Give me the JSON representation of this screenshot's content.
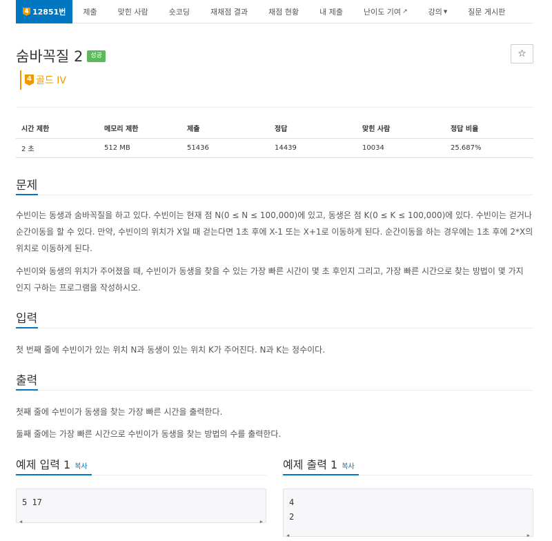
{
  "nav": {
    "active_tier": "4",
    "active_label": "12851번",
    "items": [
      "제출",
      "맞힌 사람",
      "숏코딩",
      "재채점 결과",
      "채점 현황",
      "내 제출",
      "난이도 기여",
      "강의"
    ],
    "ext_icon": "external-link-icon",
    "caret_icon": "caret-down-icon",
    "last": "질문 게시판"
  },
  "problem": {
    "title": "숨바꼭질 2",
    "status_badge": "성공",
    "star_icon": "☆",
    "tier_num": "4",
    "tier_name": "골드 IV"
  },
  "info": {
    "headers": [
      "시간 제한",
      "메모리 제한",
      "제출",
      "정답",
      "맞힌 사람",
      "정답 비율"
    ],
    "values": [
      "2 초",
      "512 MB",
      "51436",
      "14439",
      "10034",
      "25.687%"
    ]
  },
  "sections": {
    "problem_h": "문제",
    "problem_p1": "수빈이는 동생과 숨바꼭질을 하고 있다. 수빈이는 현재 점 N(0 ≤ N ≤ 100,000)에 있고, 동생은 점 K(0 ≤ K ≤ 100,000)에 있다. 수빈이는 걷거나 순간이동을 할 수 있다. 만약, 수빈이의 위치가 X일 때 걷는다면 1초 후에 X-1 또는 X+1로 이동하게 된다. 순간이동을 하는 경우에는 1초 후에 2*X의 위치로 이동하게 된다.",
    "problem_p2": "수빈이와 동생의 위치가 주어졌을 때, 수빈이가 동생을 찾을 수 있는 가장 빠른 시간이 몇 초 후인지 그리고, 가장 빠른 시간으로 찾는 방법이 몇 가지 인지 구하는 프로그램을 작성하시오.",
    "input_h": "입력",
    "input_p": "첫 번째 줄에 수빈이가 있는 위치 N과 동생이 있는 위치 K가 주어진다. N과 K는 정수이다.",
    "output_h": "출력",
    "output_p1": "첫째 줄에 수빈이가 동생을 찾는 가장 빠른 시간을 출력한다.",
    "output_p2": "둘째 줄에는 가장 빠른 시간으로 수빈이가 동생을 찾는 방법의 수를 출력한다."
  },
  "samples": {
    "input_h": "예제 입력 1",
    "output_h": "예제 출력 1",
    "copy": "복사",
    "input_text": "5 17",
    "output_line1": "4",
    "output_line2": "2"
  },
  "colors": {
    "nav_active": "#0076c0",
    "tier_gold": "#ec9a00",
    "success": "#5cb85c",
    "link": "#0076c0"
  }
}
